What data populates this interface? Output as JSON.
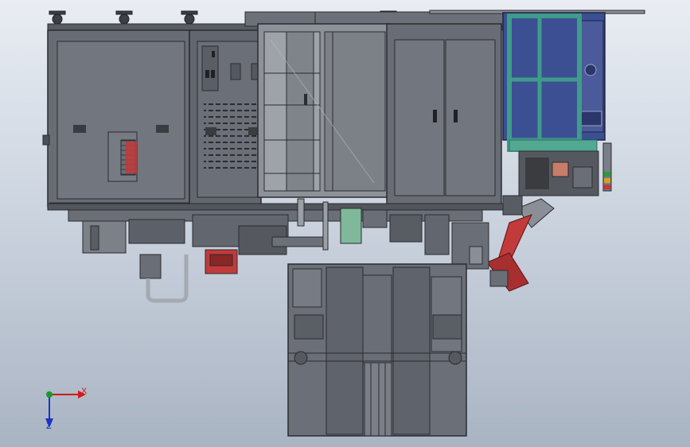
{
  "triad": {
    "x_label": "X",
    "z_label": "Z",
    "x_color": "#d11a1a",
    "z_color": "#1a33c8",
    "y_color": "#1a9a2a"
  },
  "colors": {
    "panel": "#6f737b",
    "panel_dark": "#5c6068",
    "frame": "#4b4f56",
    "line": "#2a2c30",
    "glass": "#9aa0a6",
    "teal": "#3f9c8a",
    "blue_cabinet": "#3c4f93",
    "robot_red": "#c23a3a",
    "green_block": "#7fb89a"
  }
}
